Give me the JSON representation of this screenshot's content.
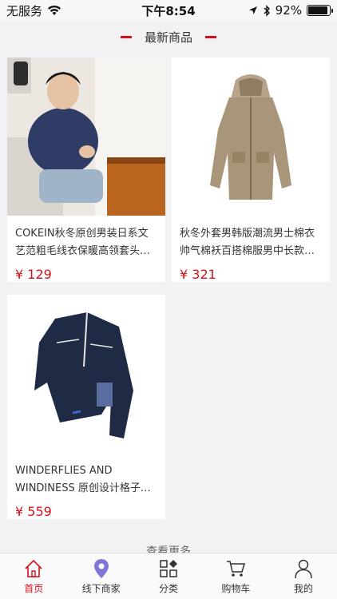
{
  "status": {
    "carrier": "无服务",
    "time": "下午8:54",
    "battery_text": "92%",
    "battery_level": 0.92
  },
  "section": {
    "title": "最新商品"
  },
  "products": [
    {
      "title": "COKEIN秋冬原创男装日系文艺范粗毛线衣保暖高领套头…",
      "price": "¥ 129"
    },
    {
      "title": "秋冬外套男韩版潮流男士棉衣帅气棉袄百搭棉服男中长款…",
      "price": "¥ 321"
    },
    {
      "title": "WINDERFLIES AND WINDINESS 原创设计格子…",
      "price": "¥ 559"
    }
  ],
  "more_label": "查看更多",
  "tabs": [
    {
      "label": "首页",
      "icon": "home-icon",
      "active": true
    },
    {
      "label": "线下商家",
      "icon": "location-pin-icon",
      "active": false
    },
    {
      "label": "分类",
      "icon": "category-grid-icon",
      "active": false
    },
    {
      "label": "购物车",
      "icon": "cart-icon",
      "active": false
    },
    {
      "label": "我的",
      "icon": "user-icon",
      "active": false
    }
  ],
  "colors": {
    "accent": "#d0111b",
    "pin": "#7f76d8"
  }
}
